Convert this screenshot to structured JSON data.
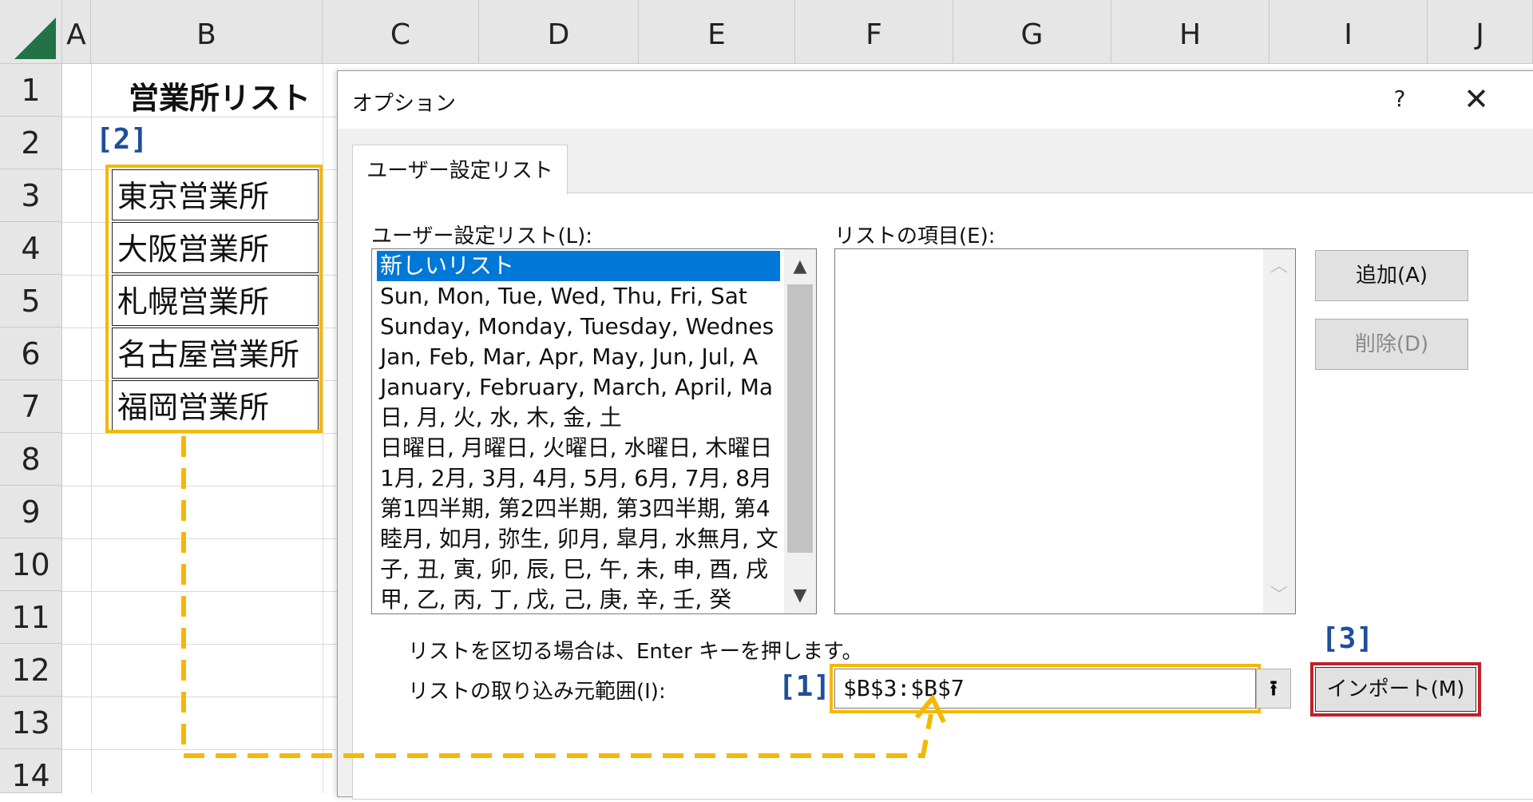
{
  "sheet": {
    "columns": [
      "A",
      "B",
      "C",
      "D",
      "E",
      "F",
      "G",
      "H",
      "I",
      "J"
    ],
    "rows": [
      "1",
      "2",
      "3",
      "4",
      "5",
      "6",
      "7",
      "8",
      "9",
      "10",
      "11",
      "12",
      "13",
      "14"
    ],
    "title_cell": "営業所リスト",
    "cells": [
      "東京営業所",
      "大阪営業所",
      "札幌営業所",
      "名古屋営業所",
      "福岡営業所"
    ],
    "step2": "[2]"
  },
  "dialog": {
    "title": "オプション",
    "help": "?",
    "close": "✕",
    "tab": "ユーザー設定リスト",
    "lists_label": "ユーザー設定リスト(L):",
    "entries_label": "リストの項目(E):",
    "lists": [
      "新しいリスト",
      "Sun, Mon, Tue, Wed, Thu, Fri, Sat",
      "Sunday, Monday, Tuesday, Wednes",
      "Jan, Feb, Mar, Apr, May, Jun, Jul, A",
      "January, February, March, April, Ma",
      "日, 月, 火, 水, 木, 金, 土",
      "日曜日, 月曜日, 火曜日, 水曜日, 木曜日",
      "1月, 2月, 3月, 4月, 5月, 6月, 7月, 8月",
      "第1四半期, 第2四半期, 第3四半期, 第4",
      "睦月, 如月, 弥生, 卯月, 皐月, 水無月, 文",
      "子, 丑, 寅, 卯, 辰, 巳, 午, 未, 申, 酉, 戌",
      "甲, 乙, 丙, 丁, 戊, 己, 庚, 辛, 壬, 癸"
    ],
    "add_button": "追加(A)",
    "delete_button": "削除(D)",
    "hint": "リストを区切る場合は、Enter キーを押します。",
    "import_label": "リストの取り込み元範囲(I):",
    "range_value": "$B$3:$B$7",
    "collapse_icon": "⭱",
    "import_button": "インポート(M)",
    "step1": "[1]",
    "step3": "[3]"
  },
  "colors": {
    "highlight_yellow": "#f5b800",
    "highlight_red": "#c0202a",
    "step_label": "#1f4e9a",
    "excel_green": "#217346",
    "selection_blue": "#0078d7"
  }
}
